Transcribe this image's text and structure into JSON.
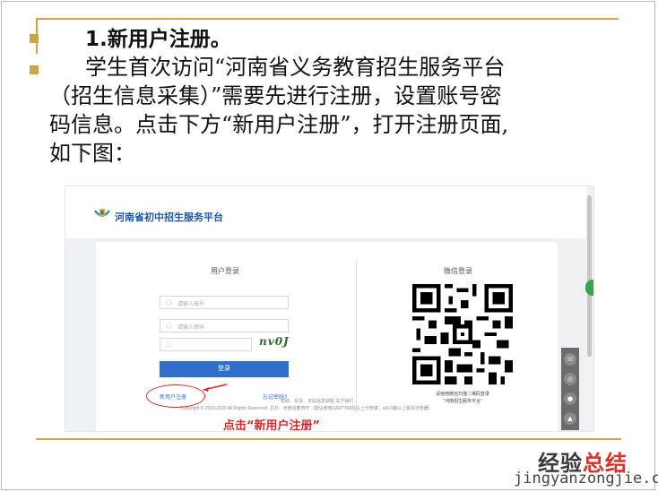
{
  "slide": {
    "title": "1.新用户注册。",
    "paragraph_lines": [
      "学生首次访问“河南省义务教育招生服务平台",
      "（招生信息采集）”需要先进行注册，设置账号密",
      "码信息。点击下方“新用户注册”，打开注册页面,",
      "如下图："
    ]
  },
  "screenshot": {
    "brand": "河南省初中招生服务平台",
    "login": {
      "title": "用户登录",
      "account_placeholder": "请输入账号",
      "password_placeholder": "请输入密码",
      "captcha_text": "nv0J",
      "login_button": "登录",
      "register_link": "新用户注册",
      "forgot_link": "忘记密码?"
    },
    "wechat": {
      "title": "微信登录",
      "caption_line1": "请使用微信扫描二维码登录",
      "caption_line2": "“河南招生服务平台”"
    },
    "footer": {
      "links": "帮助、反馈、本站信息获取  关于我们",
      "copyright": "Copyright © 2019-2020 All Rights Reserved. 主办：河南省教育厅（建议使用1280*768及以上分辨率、ie9.0或以上版本浏览器）"
    },
    "annotation": "点击“新用户注册”"
  },
  "watermark": {
    "brand_part1": "经验",
    "brand_part2": "总结",
    "url": "jingyanzongjie.com"
  },
  "colors": {
    "accent_gold": "#c9a646",
    "annotation_red": "#d42a2a",
    "login_blue": "#2f6fcb"
  }
}
